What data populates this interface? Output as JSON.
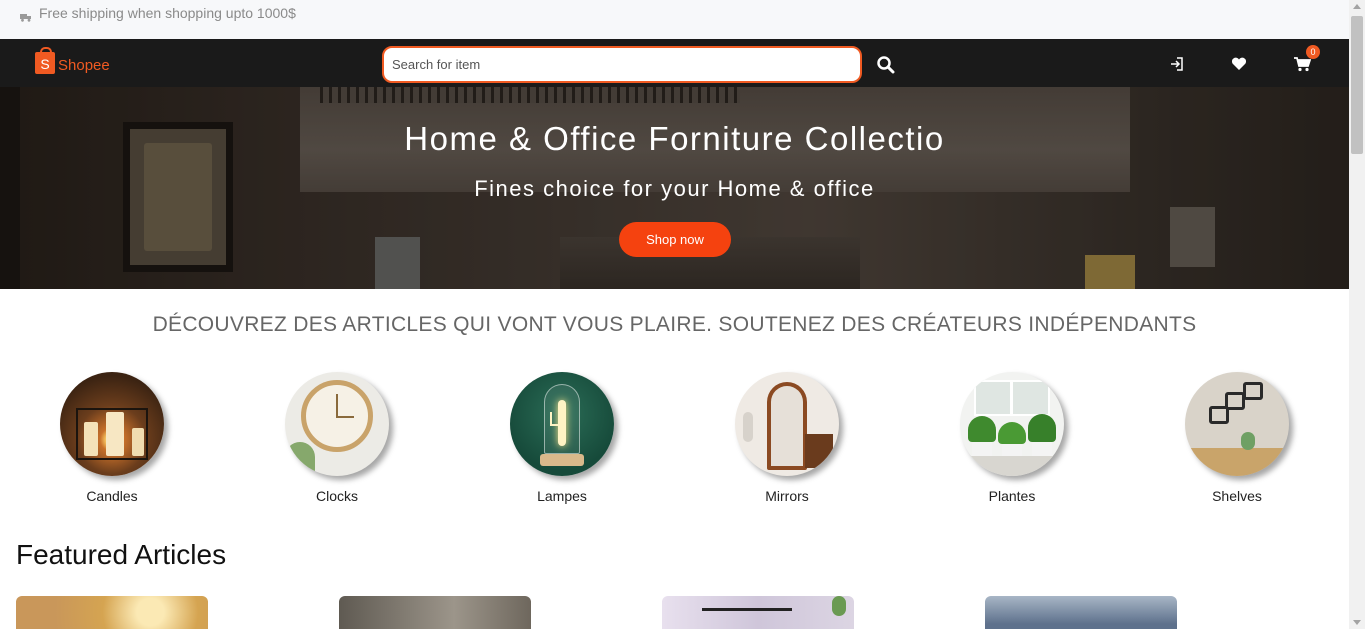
{
  "topbar": {
    "shipping_text": "Free shipping when shopping upto 1000$",
    "icon": "truck-icon"
  },
  "header": {
    "logo_letter": "S",
    "brand": "Shopee",
    "search_placeholder": "Search for item",
    "search_value": "",
    "cart_count": "0",
    "icons": [
      "search-icon",
      "login-icon",
      "heart-icon",
      "cart-icon"
    ]
  },
  "hero": {
    "title": "Home & Office Forniture Collectio",
    "subtitle": "Fines choice for your Home & office",
    "cta": "Shop now"
  },
  "discover_heading": "DÉCOUVREZ DES ARTICLES QUI VONT VOUS PLAIRE. SOUTENEZ DES CRÉATEURS INDÉPENDANTS",
  "categories": [
    {
      "label": "Candles"
    },
    {
      "label": "Clocks"
    },
    {
      "label": "Lampes"
    },
    {
      "label": "Mirrors"
    },
    {
      "label": "Plantes"
    },
    {
      "label": "Shelves"
    }
  ],
  "featured_heading": "Featured Articles",
  "colors": {
    "accent": "#f05a22",
    "header_bg": "#1a1a1a",
    "button": "#f5420f"
  }
}
